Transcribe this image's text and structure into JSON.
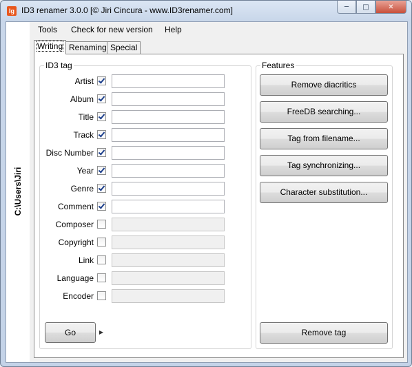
{
  "window": {
    "title": "ID3 renamer 3.0.0 [© Jiri Cincura - www.ID3renamer.com]",
    "icon_glyph": "Ig",
    "controls": [
      "minimize-icon",
      "maximize-icon",
      "close-icon"
    ]
  },
  "sidebar": {
    "path": "C:\\Users\\Jiri"
  },
  "menu": {
    "items": [
      "Tools",
      "Check for new version",
      "Help"
    ]
  },
  "tabs": [
    {
      "label": "Writing",
      "active": true
    },
    {
      "label": "Renaming",
      "active": false
    },
    {
      "label": "Special",
      "active": false
    }
  ],
  "id3tag": {
    "title": "ID3 tag",
    "fields": [
      {
        "label": "Artist",
        "checked": true,
        "value": ""
      },
      {
        "label": "Album",
        "checked": true,
        "value": ""
      },
      {
        "label": "Title",
        "checked": true,
        "value": ""
      },
      {
        "label": "Track",
        "checked": true,
        "value": ""
      },
      {
        "label": "Disc Number",
        "checked": true,
        "value": ""
      },
      {
        "label": "Year",
        "checked": true,
        "value": ""
      },
      {
        "label": "Genre",
        "checked": true,
        "value": ""
      },
      {
        "label": "Comment",
        "checked": true,
        "value": ""
      },
      {
        "label": "Composer",
        "checked": false,
        "value": ""
      },
      {
        "label": "Copyright",
        "checked": false,
        "value": ""
      },
      {
        "label": "Link",
        "checked": false,
        "value": ""
      },
      {
        "label": "Language",
        "checked": false,
        "value": ""
      },
      {
        "label": "Encoder",
        "checked": false,
        "value": ""
      }
    ],
    "go_label": "Go"
  },
  "features": {
    "title": "Features",
    "buttons": [
      "Remove diacritics",
      "FreeDB searching...",
      "Tag from filename...",
      "Tag synchronizing...",
      "Character substitution..."
    ],
    "remove_tag_label": "Remove tag"
  },
  "colors": {
    "title_bar": "#c9d7ea",
    "close_button": "#c8503b",
    "check_mark": "#1c3f8c"
  }
}
